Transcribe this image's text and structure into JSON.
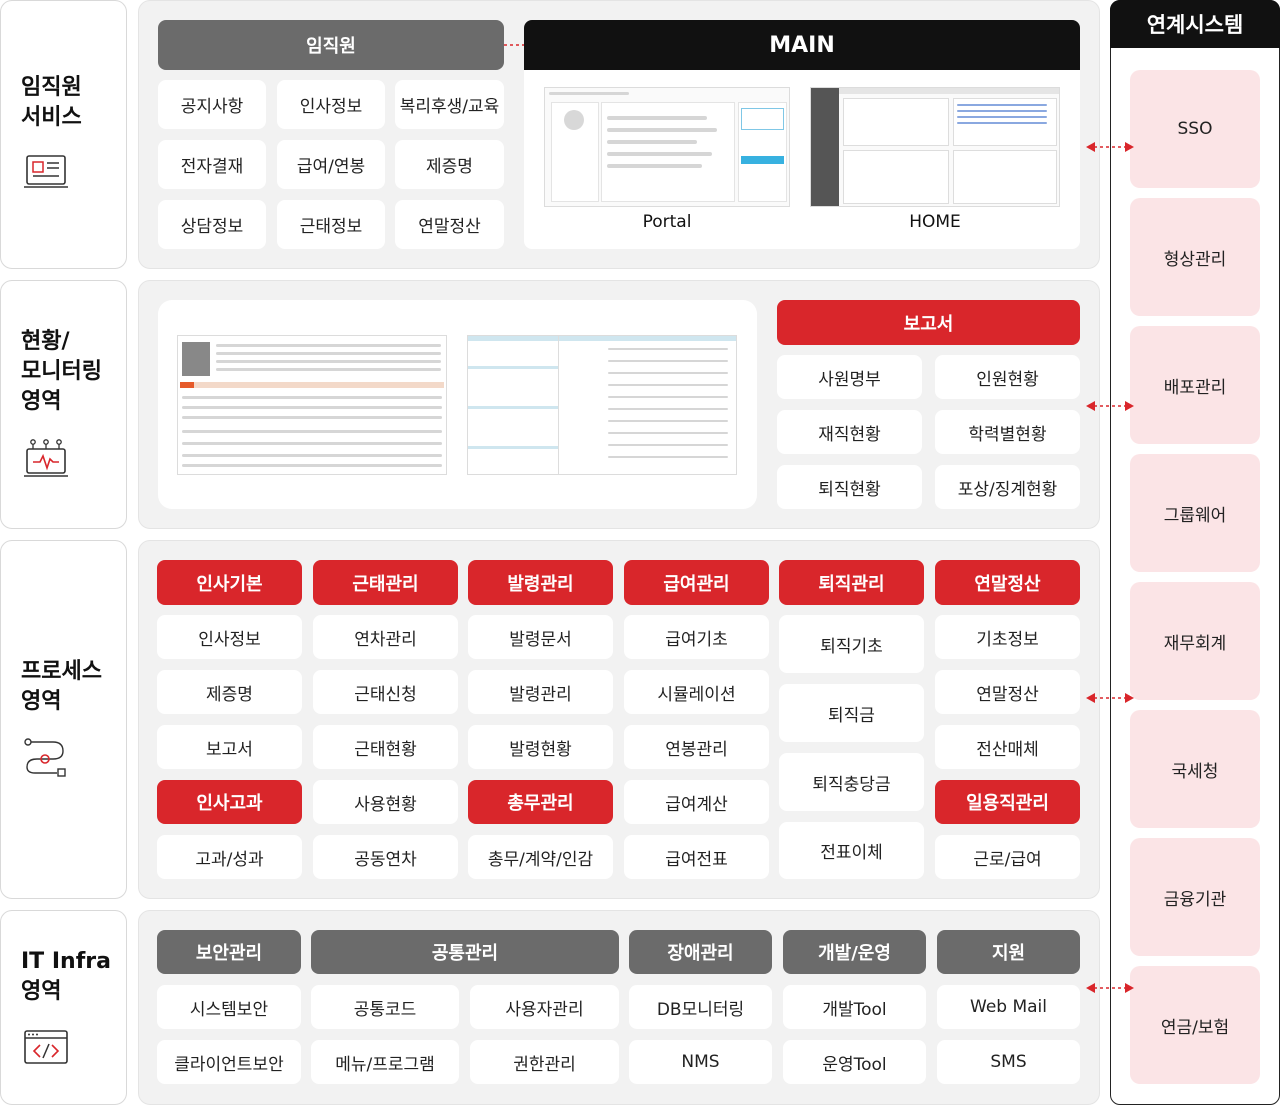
{
  "side": {
    "employee_service": "임직원\n서비스",
    "monitoring": "현황/\n모니터링\n영역",
    "process": "프로세스\n영역",
    "it_infra": "IT Infra\n영역"
  },
  "employee": {
    "header": "임직원",
    "items": [
      "공지사항",
      "인사정보",
      "복리후생/교육",
      "전자결재",
      "급여/연봉",
      "제증명",
      "상담정보",
      "근태정보",
      "연말정산"
    ],
    "main_header": "MAIN",
    "portal_caption": "Portal",
    "home_caption": "HOME"
  },
  "monitoring": {
    "report_header": "보고서",
    "items": [
      "사원명부",
      "인원현황",
      "재직현황",
      "학력별현황",
      "퇴직현황",
      "포상/징계현황"
    ]
  },
  "process": {
    "headers": [
      "인사기본",
      "근태관리",
      "발령관리",
      "급여관리",
      "퇴직관리",
      "연말정산"
    ],
    "col1": [
      "인사정보",
      "제증명",
      "보고서"
    ],
    "col1_header2": "인사고과",
    "col1_b": [
      "고과/성과"
    ],
    "col2": [
      "연차관리",
      "근태신청",
      "근태현황",
      "사용현황",
      "공동연차"
    ],
    "col3": [
      "발령문서",
      "발령관리",
      "발령현황"
    ],
    "col3_header2": "총무관리",
    "col3_b": [
      "총무/계약/인감"
    ],
    "col4": [
      "급여기초",
      "시뮬레이션",
      "연봉관리",
      "급여계산",
      "급여전표"
    ],
    "col5": [
      "퇴직기초",
      "퇴직금",
      "퇴직충당금",
      "전표이체"
    ],
    "col6": [
      "기초정보",
      "연말정산",
      "전산매체"
    ],
    "col6_header2": "일용직관리",
    "col6_b": [
      "근로/급여"
    ]
  },
  "infra": {
    "headers": [
      "보안관리",
      "공통관리",
      "장애관리",
      "개발/운영",
      "지원"
    ],
    "security": [
      "시스템보안",
      "클라이언트보안"
    ],
    "common_a": [
      "공통코드",
      "메뉴/프로그램"
    ],
    "common_b": [
      "사용자관리",
      "권한관리"
    ],
    "fault": [
      "DB모니터링",
      "NMS"
    ],
    "dev": [
      "개발Tool",
      "운영Tool"
    ],
    "support": [
      "Web Mail",
      "SMS"
    ]
  },
  "link": {
    "header": "연계시스템",
    "items": [
      "SSO",
      "형상관리",
      "배포관리",
      "그룹웨어",
      "재무회계",
      "국세청",
      "금융기관",
      "연금/보험"
    ]
  },
  "colors": {
    "accent_red": "#d9262b",
    "dark_gray": "#6b6b6b",
    "pink": "#fbe4e6",
    "panel": "#f2f2f2"
  }
}
